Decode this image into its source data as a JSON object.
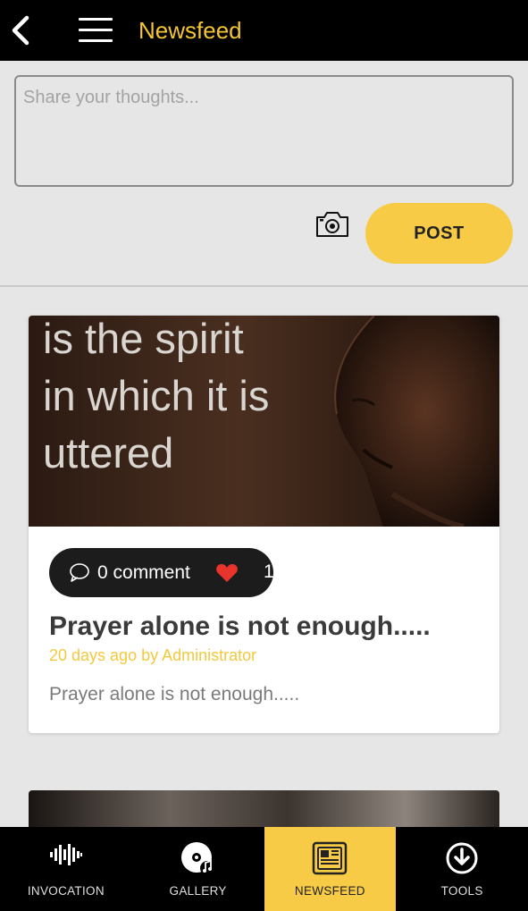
{
  "header": {
    "title": "Newsfeed"
  },
  "composer": {
    "placeholder": "Share your thoughts..."
  },
  "actions": {
    "post_label": "POST"
  },
  "post": {
    "image_text_line1": "is the spirit",
    "image_text_line2": "in which it is",
    "image_text_line3": "uttered",
    "comment_count_label": "0 comment",
    "like_count": "1",
    "title": "Prayer alone is not enough.....",
    "meta": "20 days ago by Administrator",
    "excerpt": "Prayer alone is not enough....."
  },
  "tabs": [
    {
      "label": "INVOCATION",
      "icon": "waveform-icon",
      "active": false
    },
    {
      "label": "GALLERY",
      "icon": "record-music-icon",
      "active": false
    },
    {
      "label": "NEWSFEED",
      "icon": "newspaper-icon",
      "active": true
    },
    {
      "label": "TOOLS",
      "icon": "download-circle-icon",
      "active": false
    }
  ],
  "colors": {
    "accent": "#f7cb45",
    "header_bg": "#000000",
    "heart": "#e8342c"
  }
}
